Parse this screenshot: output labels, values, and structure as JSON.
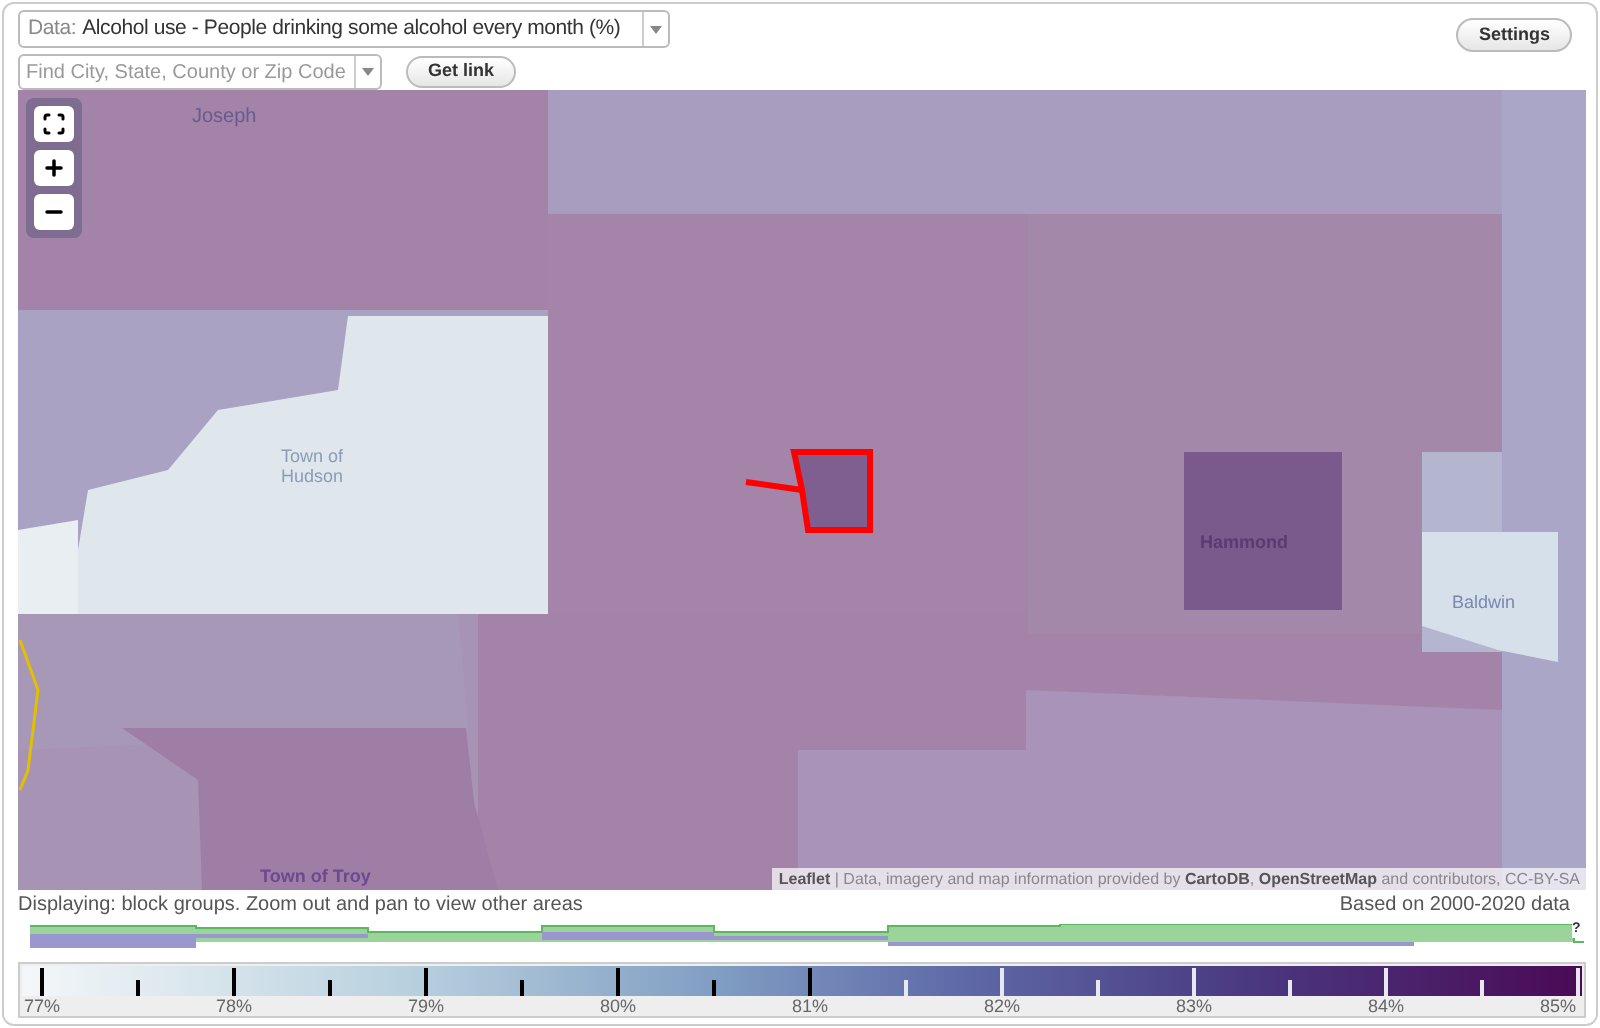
{
  "data_select": {
    "label": "Data:",
    "value": "Alcohol use - People drinking some alcohol every month (%)"
  },
  "search": {
    "placeholder": "Find City, State, County or Zip Code"
  },
  "buttons": {
    "get_link": "Get link",
    "settings": "Settings"
  },
  "map": {
    "place_labels": [
      {
        "text": "Joseph",
        "kind": "town"
      },
      {
        "text": "Town of Hudson",
        "kind": "town"
      },
      {
        "text": "Hammond",
        "kind": "city"
      },
      {
        "text": "Baldwin",
        "kind": "town"
      },
      {
        "text": "Town of Troy",
        "kind": "town"
      }
    ],
    "attribution": "**Leaflet** | Data, imagery and map information provided by **CartoDB**, **OpenStreetMap** and contributors, CC-BY-SA"
  },
  "status": {
    "displaying": "Displaying: block groups. Zoom out and pan to view other areas",
    "based_on": "Based on 2000-2020 data"
  },
  "histogram": {
    "marker": "?"
  },
  "legend": {
    "labels": [
      "77%",
      "78%",
      "79%",
      "80%",
      "81%",
      "82%",
      "83%",
      "84%",
      "85%"
    ]
  }
}
